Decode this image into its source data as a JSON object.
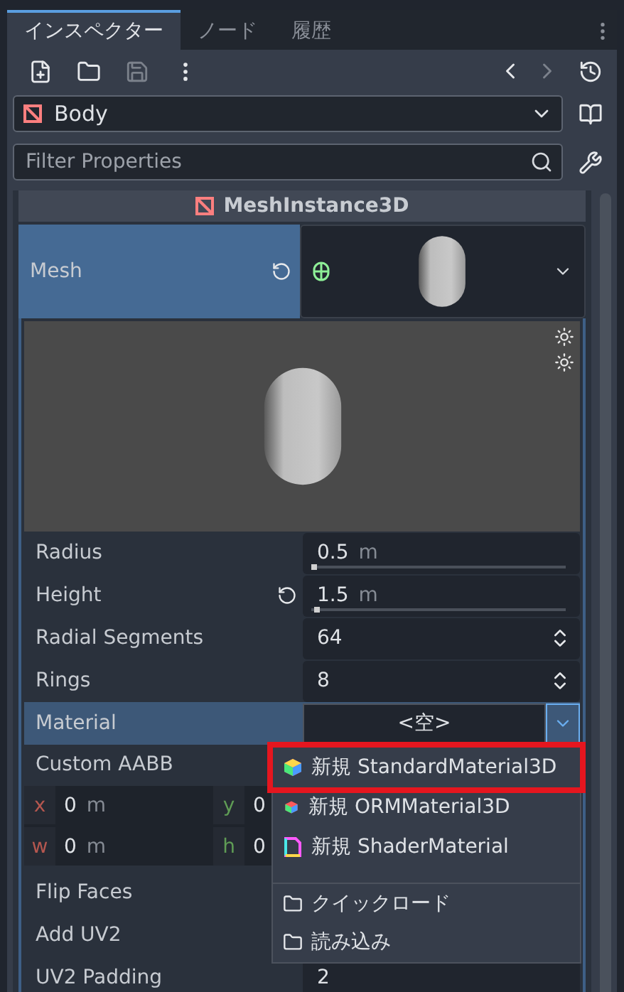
{
  "tabs": [
    {
      "label": "インスペクター",
      "selected": true
    },
    {
      "label": "ノード",
      "selected": false
    },
    {
      "label": "履歴",
      "selected": false
    }
  ],
  "toolbar": [
    {
      "kind": "new",
      "disabled": false
    },
    {
      "kind": "open",
      "disabled": false
    },
    {
      "kind": "save",
      "disabled": true
    },
    {
      "kind": "more",
      "disabled": false
    }
  ],
  "history": [
    {
      "kind": "back",
      "disabled": false
    },
    {
      "kind": "forward",
      "disabled": true
    }
  ],
  "object_select": {
    "value": "Body"
  },
  "filter": {
    "placeholder": "Filter Properties"
  },
  "section": {
    "title": "MeshInstance3D"
  },
  "mesh": {
    "label": "Mesh",
    "selected": true,
    "revertable": true
  },
  "properties": [
    {
      "kind": "slider",
      "label": "Radius",
      "value": "0.5",
      "unit": "m",
      "level": 0,
      "revertable": false
    },
    {
      "kind": "slider",
      "label": "Height",
      "value": "1.5",
      "unit": "m",
      "level": 0.01,
      "revertable": true
    },
    {
      "kind": "spin",
      "label": "Radial Segments",
      "value": "64"
    },
    {
      "kind": "spin",
      "label": "Rings",
      "value": "8"
    },
    {
      "kind": "resource",
      "label": "Material",
      "value": "<空>",
      "selected": true
    },
    {
      "kind": "aabb",
      "label": "Custom AABB",
      "fields": [
        {
          "axis": "x",
          "value": "0",
          "unit": "m"
        },
        {
          "axis": "y",
          "value": "0"
        },
        {
          "axis": "w",
          "value": "0",
          "unit": "m"
        },
        {
          "axis": "h",
          "value": "0"
        }
      ]
    },
    {
      "kind": "plain",
      "label": "Flip Faces"
    },
    {
      "kind": "plain",
      "label": "Add UV2"
    },
    {
      "kind": "number",
      "label": "UV2 Padding",
      "value": "2"
    }
  ],
  "menu": {
    "items": [
      {
        "kind": "standard",
        "label": "新規 StandardMaterial3D",
        "highlighted": true,
        "separator": false
      },
      {
        "kind": "orm",
        "label": "新規 ORMMaterial3D",
        "highlighted": false,
        "separator": false
      },
      {
        "kind": "shader",
        "label": "新規 ShaderMaterial",
        "highlighted": false,
        "separator": false
      },
      {
        "kind": "folder",
        "label": "クイックロード",
        "highlighted": false,
        "separator": true
      },
      {
        "kind": "folder",
        "label": "読み込み",
        "highlighted": false,
        "separator": false
      }
    ]
  }
}
